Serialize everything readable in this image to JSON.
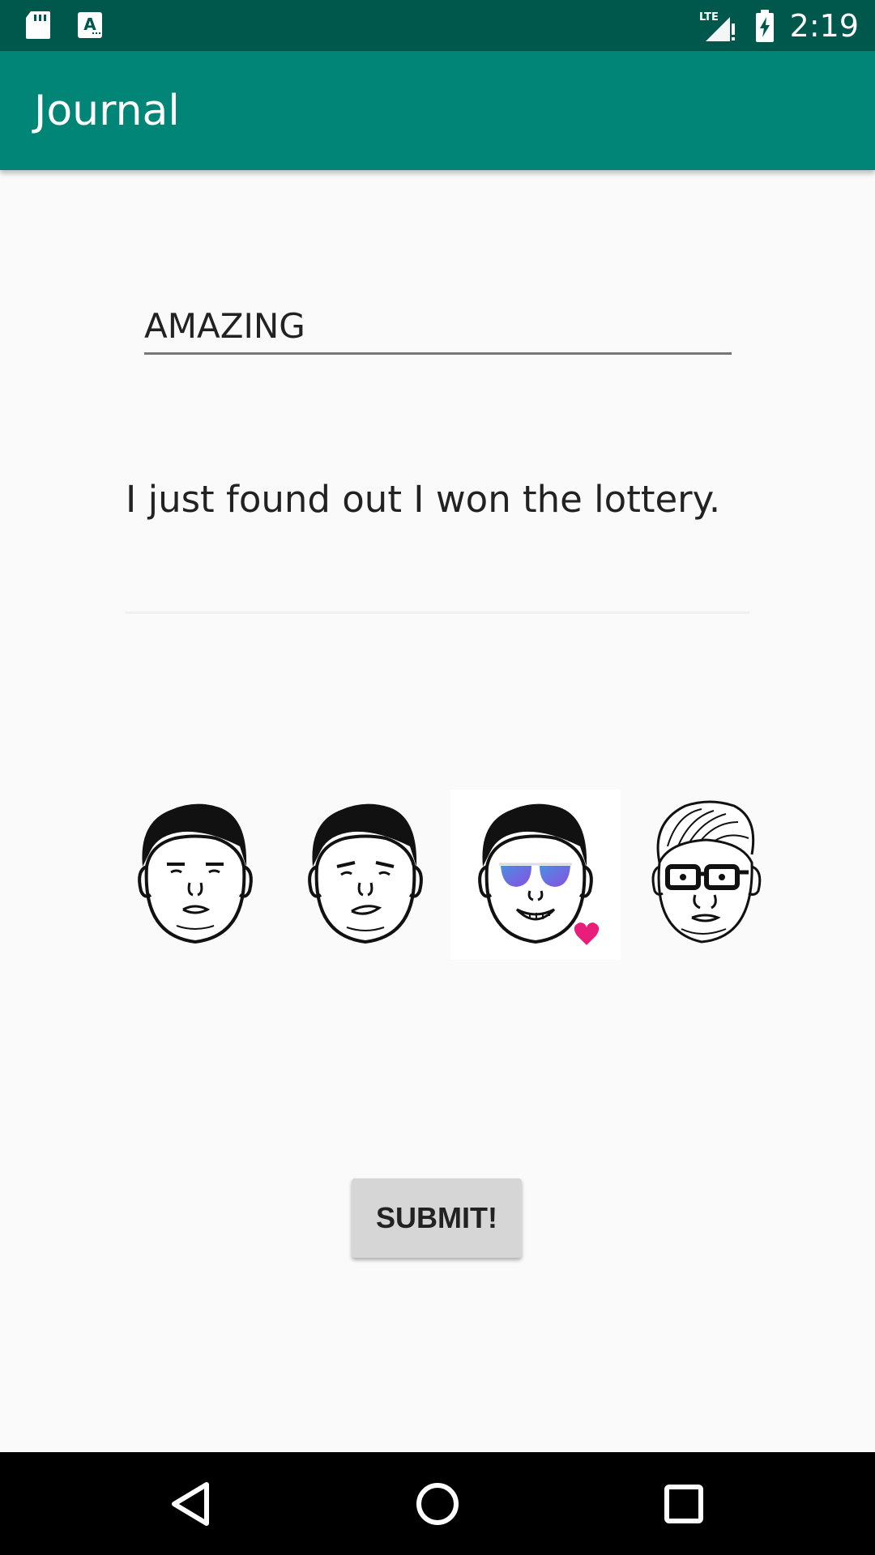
{
  "status_bar": {
    "time": "2:19",
    "icons": [
      "sd-card-icon",
      "text-a-icon",
      "lte-signal-icon",
      "battery-charging-icon"
    ]
  },
  "app_bar": {
    "title": "Journal"
  },
  "form": {
    "title_value": "AMAZING",
    "entry_value": "I just found out I won the lottery."
  },
  "moods": [
    {
      "name": "neutral-face-icon",
      "selected": false
    },
    {
      "name": "displeased-face-icon",
      "selected": false
    },
    {
      "name": "cool-sunglasses-face-icon",
      "selected": true
    },
    {
      "name": "glasses-face-icon",
      "selected": false
    }
  ],
  "submit": {
    "label": "SUBMIT!"
  },
  "colors": {
    "status_bar": "#00574b",
    "app_bar": "#008577",
    "heart": "#e91e7a"
  }
}
